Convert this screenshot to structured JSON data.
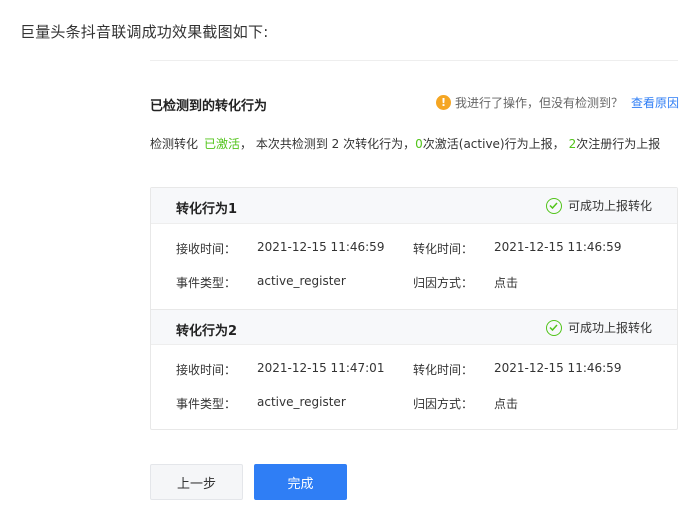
{
  "intro_text": "巨量头条抖音联调成功效果截图如下:",
  "section": {
    "title": "已检测到的转化行为",
    "help_text": "我进行了操作，但没有检测到？",
    "help_link": "查看原因"
  },
  "summary": {
    "prefix": "检测转化",
    "status": "已激活",
    "part1": "，  本次共检测到 2 次转化行为，",
    "active_count": "0",
    "part2": "次激活(active)行为上报，",
    "register_count": "2",
    "part3": "次注册行为上报"
  },
  "labels": {
    "receive_time": "接收时间：",
    "convert_time": "转化时间：",
    "event_type": "事件类型：",
    "attribution": "归因方式："
  },
  "items": [
    {
      "title": "转化行为1",
      "status": "可成功上报转化",
      "receive_time": "2021-12-15 11:46:59",
      "convert_time": "2021-12-15 11:46:59",
      "event_type": "active_register",
      "attribution": "点击"
    },
    {
      "title": "转化行为2",
      "status": "可成功上报转化",
      "receive_time": "2021-12-15 11:47:01",
      "convert_time": "2021-12-15 11:46:59",
      "event_type": "active_register",
      "attribution": "点击"
    }
  ],
  "buttons": {
    "prev": "上一步",
    "done": "完成"
  },
  "colors": {
    "primary": "#2f7ef5",
    "success": "#52c41a",
    "warning": "#f5a623"
  }
}
